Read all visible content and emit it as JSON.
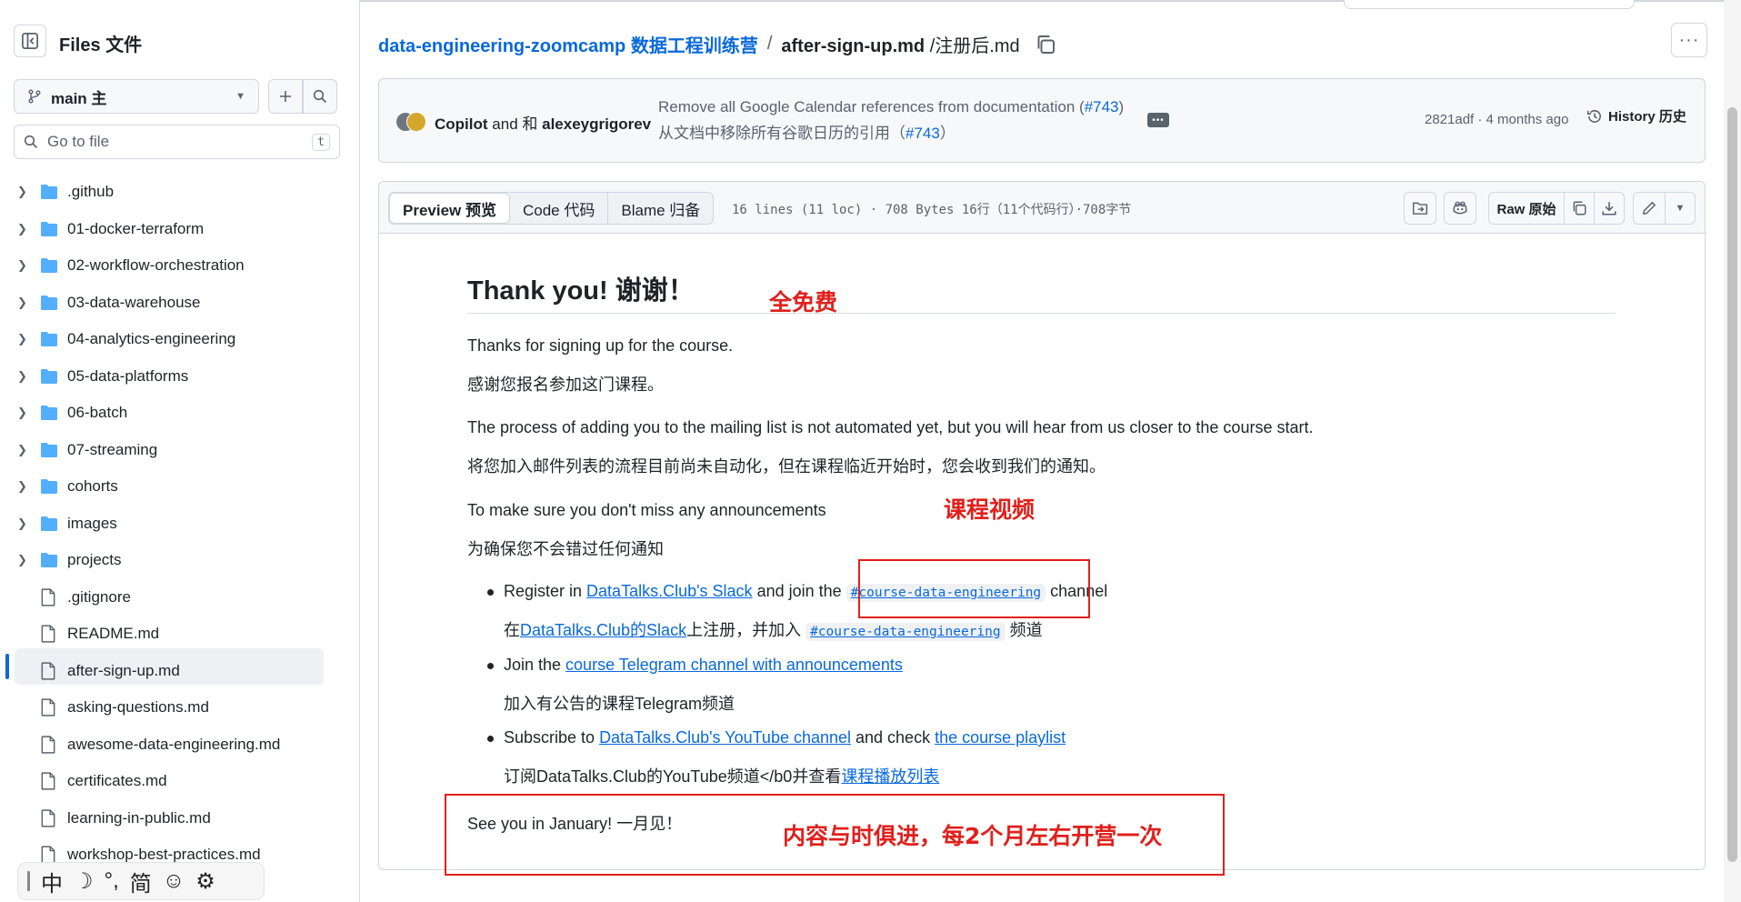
{
  "sidebar": {
    "title": "Files 文件",
    "branch": "main 主",
    "goto_placeholder": "Go to file",
    "goto_shortcut": "t",
    "items": [
      {
        "label": ".github",
        "type": "folder"
      },
      {
        "label": "01-docker-terraform",
        "type": "folder"
      },
      {
        "label": "02-workflow-orchestration",
        "type": "folder"
      },
      {
        "label": "03-data-warehouse",
        "type": "folder"
      },
      {
        "label": "04-analytics-engineering",
        "type": "folder"
      },
      {
        "label": "05-data-platforms",
        "type": "folder"
      },
      {
        "label": "06-batch",
        "type": "folder"
      },
      {
        "label": "07-streaming",
        "type": "folder"
      },
      {
        "label": "cohorts",
        "type": "folder"
      },
      {
        "label": "images",
        "type": "folder"
      },
      {
        "label": "projects",
        "type": "folder"
      },
      {
        "label": ".gitignore",
        "type": "file"
      },
      {
        "label": "README.md",
        "type": "file"
      },
      {
        "label": "after-sign-up.md",
        "type": "file",
        "active": true
      },
      {
        "label": "asking-questions.md",
        "type": "file"
      },
      {
        "label": "awesome-data-engineering.md",
        "type": "file"
      },
      {
        "label": "certificates.md",
        "type": "file"
      },
      {
        "label": "learning-in-public.md",
        "type": "file"
      },
      {
        "label": "workshop-best-practices.md",
        "type": "file"
      }
    ]
  },
  "ime_bar": {
    "mode": "中",
    "moon": "☽",
    "punct": "°,",
    "script": "简",
    "emoji": "☺",
    "settings": "⚙"
  },
  "breadcrumb": {
    "repo": "data-engineering-zoomcamp 数据工程训练营",
    "separator": "/",
    "file": "after-sign-up.md",
    "file_cn": "/注册后.md"
  },
  "commit": {
    "author1": "Copilot",
    "and": "and 和",
    "author2": "alexeygrigorev",
    "message_prefix": "Remove all Google Calendar references from documentation (",
    "pr": "#743",
    "message_suffix": ")",
    "message_cn_prefix": "从文档中移除所有谷歌日历的引用（",
    "message_cn_suffix": "）",
    "meta": "2821adf · 4 months ago",
    "history": "History 历史"
  },
  "file_header": {
    "tabs": [
      "Preview 预览",
      "Code 代码",
      "Blame 归备"
    ],
    "info": "16 lines (11 loc) · 708 Bytes 16行（11个代码行）·708字节",
    "raw": "Raw 原始"
  },
  "markdown": {
    "heading": "Thank you! 谢谢！",
    "p1_en": "Thanks for signing up for the course.",
    "p1_cn": "感谢您报名参加这门课程。",
    "p2_en": "The process of adding you to the mailing list is not automated yet, but you will hear from us closer to the course start.",
    "p2_cn": "将您加入邮件列表的流程目前尚未自动化，但在课程临近开始时，您会收到我们的通知。",
    "p3_en": "To make sure you don't miss any announcements",
    "p3_cn": "为确保您不会错过任何通知",
    "li1": {
      "pre": "Register in ",
      "link": "DataTalks.Club's Slack",
      "mid": " and join the ",
      "code": "#course-data-engineering",
      "post": " channel"
    },
    "li1_cn": {
      "pre": "在",
      "link": "DataTalks.Club的Slack",
      "mid": "上注册，并加入 ",
      "code": "#course-data-engineering",
      "post": " 频道"
    },
    "li2": {
      "pre": "Join the ",
      "link": "course Telegram channel with announcements"
    },
    "li2_cn": "加入有公告的课程Telegram频道",
    "li3": {
      "pre": "Subscribe to ",
      "link1": "DataTalks.Club's YouTube channel",
      "mid": " and check ",
      "link2": "the course playlist"
    },
    "li3_cn": {
      "pre": "订阅DataTalks.Club的YouTube频道</b0并查看",
      "link": "课程播放列表"
    },
    "closing": "See you in January! 一月见！"
  },
  "annotations": {
    "free": "全免费",
    "videos": "课程视频",
    "frequency": "内容与时俱进，每2个月左右开营一次",
    "color": "#e0201c"
  },
  "colors": {
    "link": "#0969da",
    "accent_bar": "#0969da",
    "folder": "#54aeff"
  }
}
